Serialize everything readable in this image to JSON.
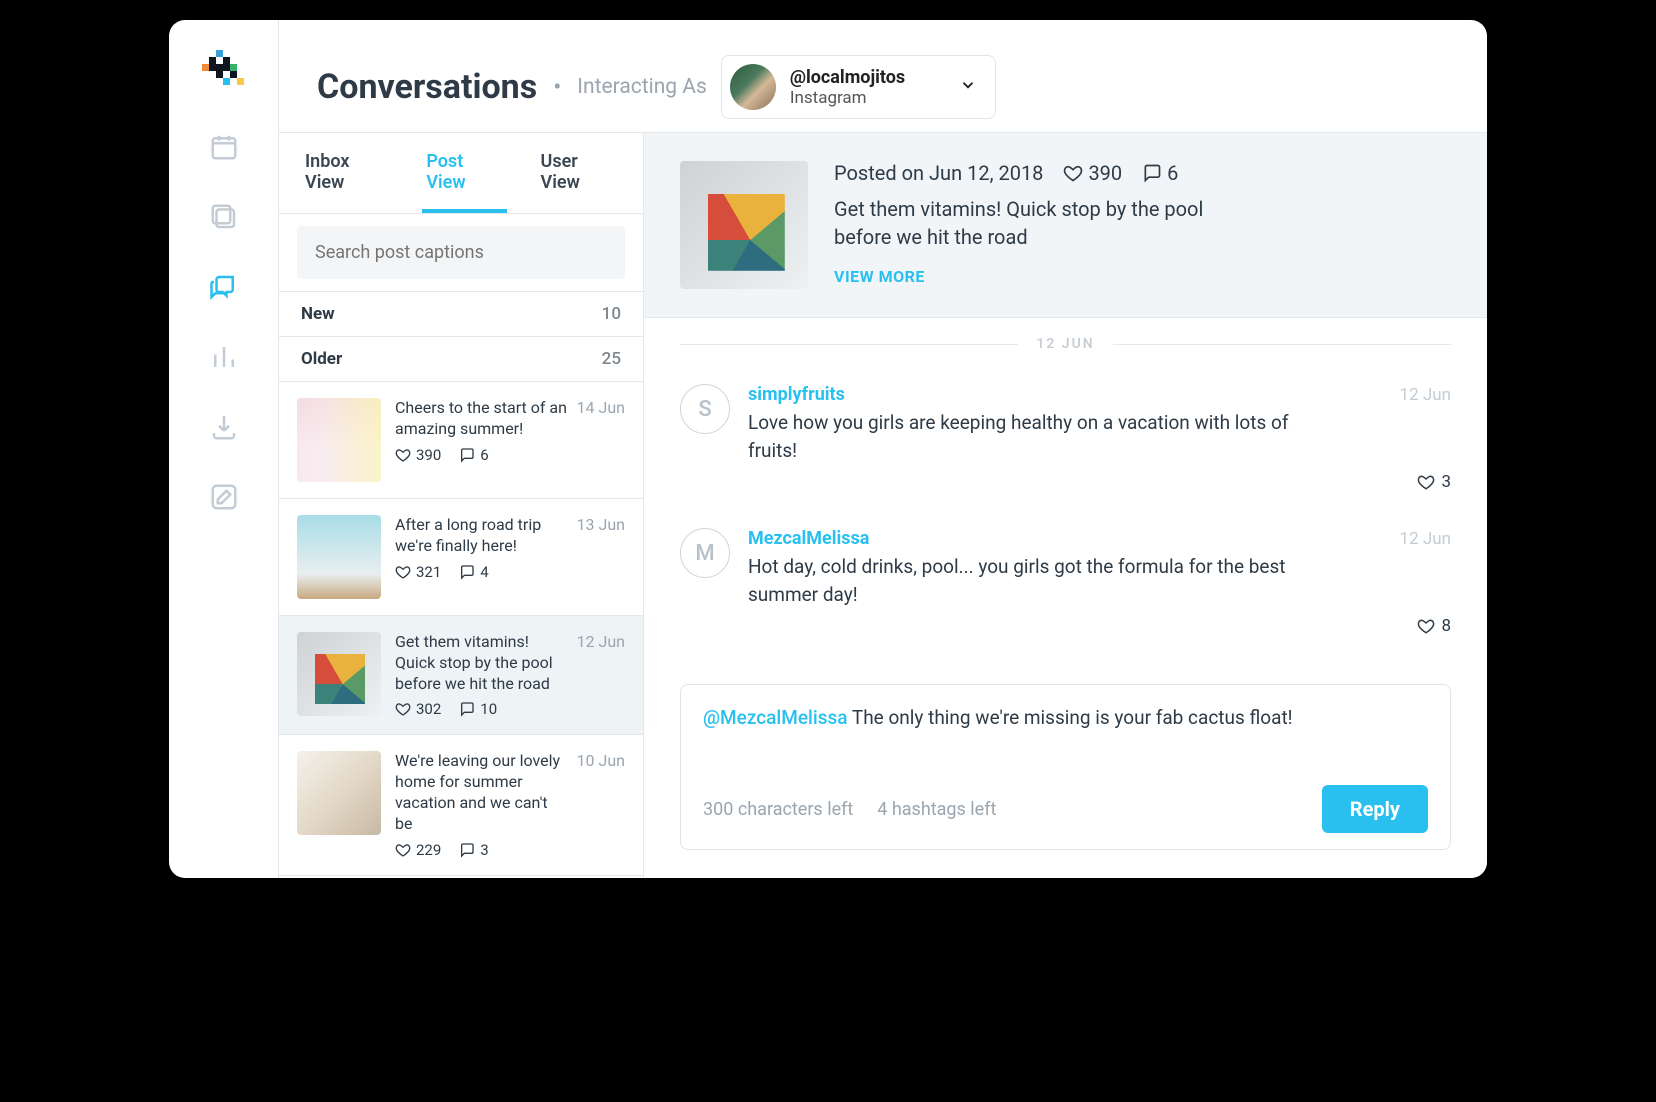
{
  "header": {
    "title": "Conversations",
    "subtitle": "Interacting As",
    "account": {
      "handle": "@localmojitos",
      "platform": "Instagram"
    }
  },
  "tabs": [
    {
      "label": "Inbox View",
      "active": false
    },
    {
      "label": "Post View",
      "active": true
    },
    {
      "label": "User View",
      "active": false
    }
  ],
  "search": {
    "placeholder": "Search post captions"
  },
  "sections": {
    "new": {
      "label": "New",
      "count": "10"
    },
    "older": {
      "label": "Older",
      "count": "25"
    }
  },
  "posts": [
    {
      "caption": "Cheers to the start of an amazing summer!",
      "date": "14 Jun",
      "likes": "390",
      "comments": "6",
      "selected": false,
      "thumb": "t1"
    },
    {
      "caption": "After a long road trip we're finally here!",
      "date": "13 Jun",
      "likes": "321",
      "comments": "4",
      "selected": false,
      "thumb": "t2"
    },
    {
      "caption": "Get them vitamins! Quick stop by the pool before we hit the road",
      "date": "12 Jun",
      "likes": "302",
      "comments": "10",
      "selected": true,
      "thumb": "t3"
    },
    {
      "caption": "We're leaving our lovely home for summer vacation and we can't be",
      "date": "10 Jun",
      "likes": "229",
      "comments": "3",
      "selected": false,
      "thumb": "t4"
    }
  ],
  "detail": {
    "posted_line": "Posted on Jun 12, 2018",
    "likes": "390",
    "comments": "6",
    "caption": "Get them vitamins! Quick stop by the pool before we hit the road",
    "view_more": "VIEW MORE",
    "date_divider": "12 JUN"
  },
  "comment_list": [
    {
      "initial": "S",
      "user": "simplyfruits",
      "date": "12 Jun",
      "text": "Love how you girls are keeping healthy on a vacation with lots of fruits!",
      "likes": "3"
    },
    {
      "initial": "M",
      "user": "MezcalMelissa",
      "date": "12 Jun",
      "text": "Hot day, cold drinks, pool... you girls got the formula for the best summer day!",
      "likes": "8"
    }
  ],
  "reply": {
    "mention": "@MezcalMelissa",
    "draft": "The only thing we're missing is your fab cactus float!",
    "chars_left": "300 characters left",
    "hashtags_left": "4 hashtags left",
    "button": "Reply"
  }
}
